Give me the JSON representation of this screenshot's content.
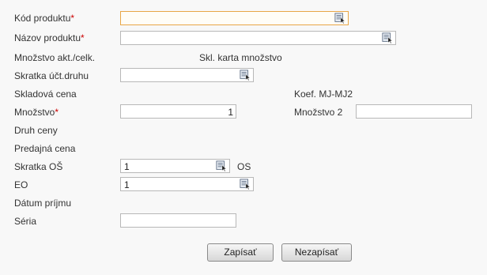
{
  "form": {
    "kod_produktu": {
      "label": "Kód produktu",
      "required_mark": "*",
      "value": ""
    },
    "nazov_produktu": {
      "label": "Názov produktu",
      "required_mark": "*",
      "value": ""
    },
    "mnozstvo_akt": {
      "label": "Množstvo akt./celk."
    },
    "skl_karta": {
      "label": "Skl. karta množstvo"
    },
    "skratka_uct": {
      "label": "Skratka účt.druhu",
      "value": ""
    },
    "skladova_cena": {
      "label": "Skladová cena"
    },
    "koef": {
      "label": "Koef. MJ-MJ2"
    },
    "mnozstvo": {
      "label": "Množstvo",
      "required_mark": "*",
      "value": "1"
    },
    "mnozstvo2": {
      "label": "Množstvo 2",
      "value": ""
    },
    "druh_ceny": {
      "label": "Druh ceny"
    },
    "predajna_cena": {
      "label": "Predajná cena"
    },
    "skratka_os": {
      "label": "Skratka OŠ",
      "value": "1",
      "unit": "OS"
    },
    "eo": {
      "label": "EO",
      "value": "1"
    },
    "datum_prijmu": {
      "label": "Dátum príjmu"
    },
    "seria": {
      "label": "Séria",
      "value": ""
    }
  },
  "buttons": {
    "save": "Zapísať",
    "cancel": "Nezapísať"
  },
  "icons": {
    "picker": "list-picker-icon"
  },
  "colors": {
    "required": "#cc0000",
    "focus_border": "#e8a646"
  }
}
